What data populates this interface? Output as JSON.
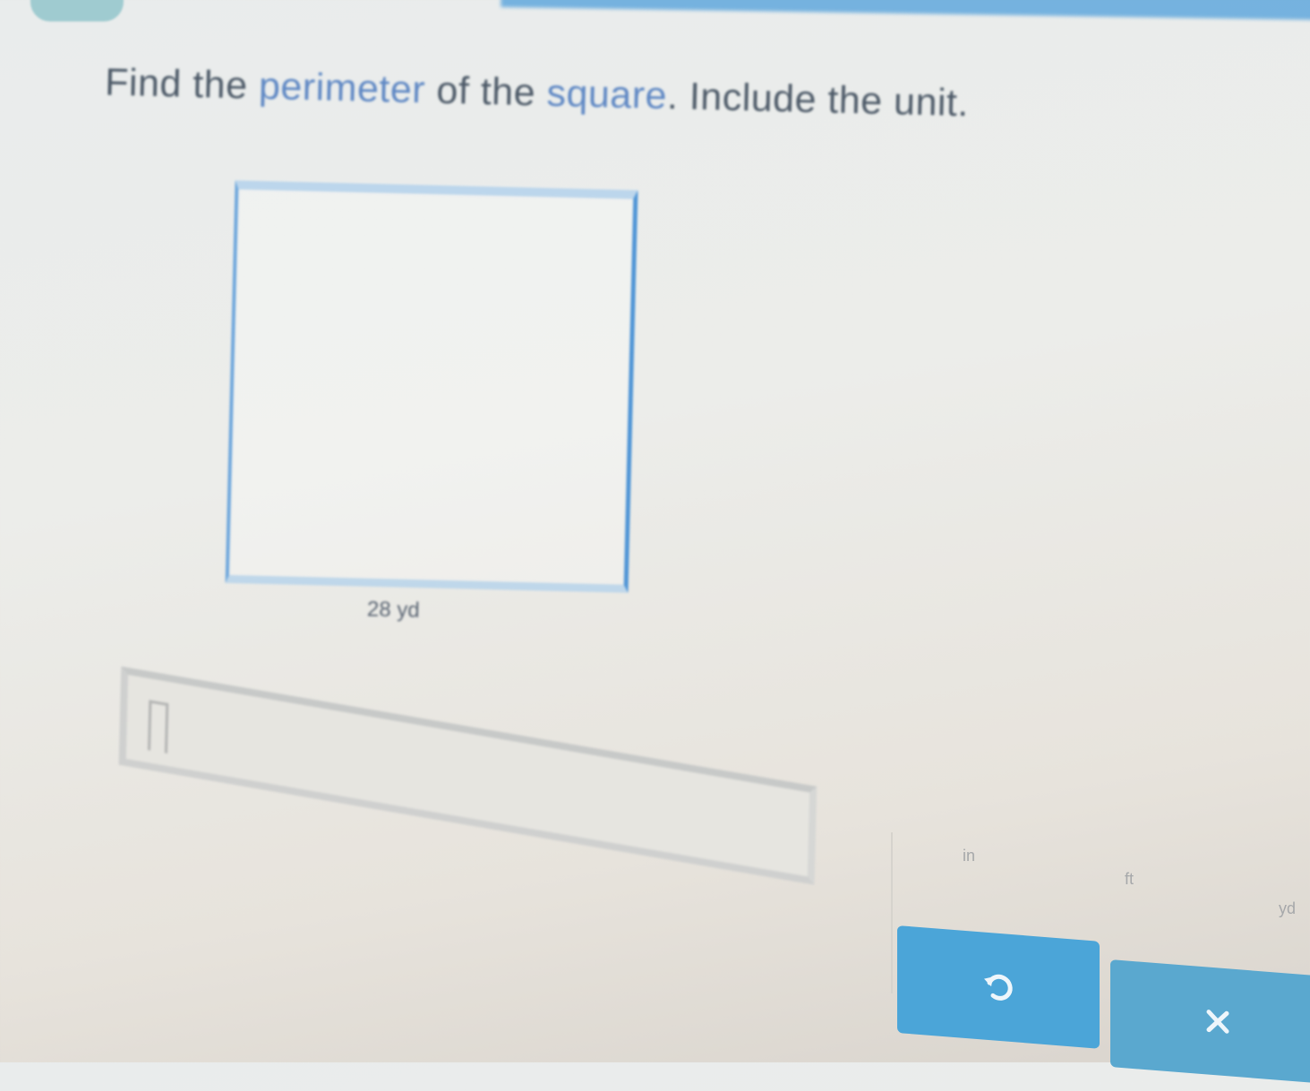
{
  "question": {
    "prefix": "Find the",
    "term_perimeter": "perimeter",
    "middle": "of the",
    "term_square": "square",
    "suffix": ". Include the unit."
  },
  "figure": {
    "shape": "square",
    "side_label": "28 yd"
  },
  "answer": {
    "value": ""
  },
  "units": {
    "in": "in",
    "ft": "ft",
    "yd": "yd"
  },
  "buttons": {
    "undo_icon": "undo-icon",
    "clear_icon": "clear-x-icon"
  },
  "colors": {
    "accent": "#4f95d6",
    "button": "#4ba5d8",
    "text": "#4d5a68",
    "term": "#5f88c4"
  }
}
